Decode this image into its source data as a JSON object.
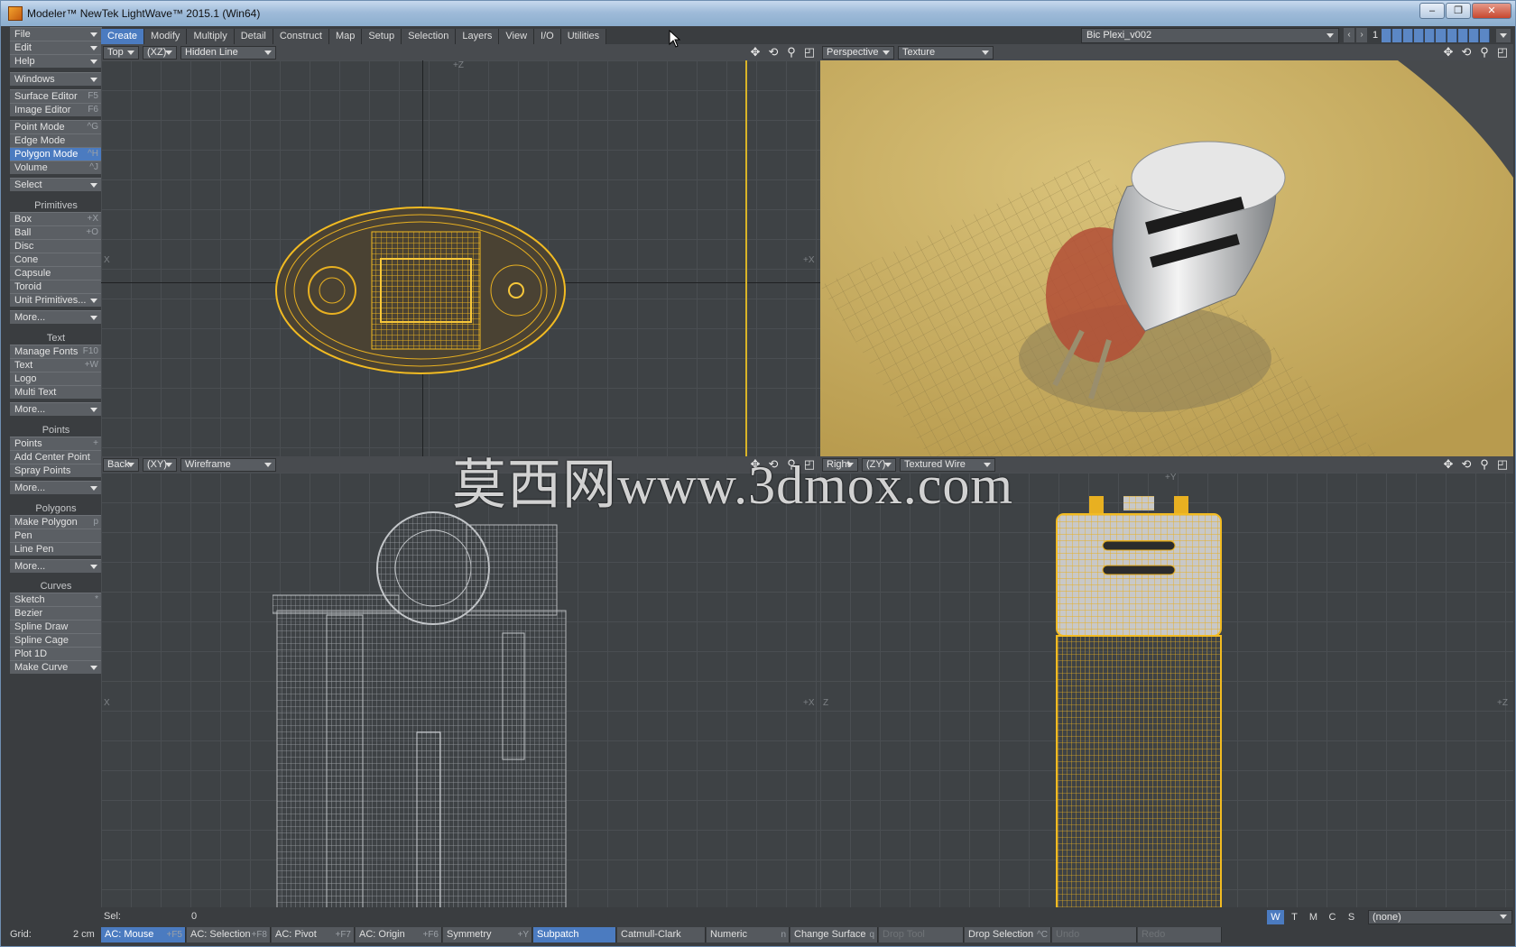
{
  "window": {
    "title": "Modeler™ NewTek LightWave™ 2015.1 (Win64)",
    "controls": [
      "–",
      "❐",
      "✕"
    ]
  },
  "left_menu": {
    "top": [
      {
        "label": "File",
        "dd": true
      },
      {
        "label": "Edit",
        "dd": true
      },
      {
        "label": "Help",
        "dd": true
      },
      {
        "label": "Windows",
        "dd": true
      },
      {
        "label": "Surface Editor",
        "shortcut": "F5"
      },
      {
        "label": "Image Editor",
        "shortcut": "F6"
      },
      {
        "label": "Point Mode",
        "shortcut": "^G"
      },
      {
        "label": "Edge Mode",
        "shortcut": ""
      },
      {
        "label": "Polygon Mode",
        "shortcut": "^H"
      },
      {
        "label": "Volume",
        "shortcut": "^J"
      },
      {
        "label": "Select",
        "dd": true
      }
    ],
    "primitives_header": "Primitives",
    "primitives": [
      {
        "label": "Box",
        "shortcut": "+X"
      },
      {
        "label": "Ball",
        "shortcut": "+O"
      },
      {
        "label": "Disc"
      },
      {
        "label": "Cone"
      },
      {
        "label": "Capsule"
      },
      {
        "label": "Toroid"
      },
      {
        "label": "Unit Primitives...",
        "dd": true
      },
      {
        "label": "More...",
        "dd": true
      }
    ],
    "text_header": "Text",
    "text": [
      {
        "label": "Manage Fonts",
        "shortcut": "F10"
      },
      {
        "label": "Text",
        "shortcut": "+W"
      },
      {
        "label": "Logo"
      },
      {
        "label": "Multi Text"
      },
      {
        "label": "More...",
        "dd": true
      }
    ],
    "points_header": "Points",
    "points": [
      {
        "label": "Points",
        "shortcut": "+"
      },
      {
        "label": "Add Center Point"
      },
      {
        "label": "Spray Points"
      },
      {
        "label": "More...",
        "dd": true
      }
    ],
    "polygons_header": "Polygons",
    "polygons": [
      {
        "label": "Make Polygon",
        "shortcut": "p"
      },
      {
        "label": "Pen"
      },
      {
        "label": "Line Pen"
      },
      {
        "label": "More...",
        "dd": true
      }
    ],
    "curves_header": "Curves",
    "curves": [
      {
        "label": "Sketch",
        "shortcut": "*"
      },
      {
        "label": "Bezier"
      },
      {
        "label": "Spline Draw"
      },
      {
        "label": "Spline Cage"
      },
      {
        "label": "Plot 1D"
      },
      {
        "label": "Make Curve",
        "dd": true
      }
    ]
  },
  "tabs": [
    "Create",
    "Modify",
    "Multiply",
    "Detail",
    "Construct",
    "Map",
    "Setup",
    "Selection",
    "Layers",
    "View",
    "I/O",
    "Utilities"
  ],
  "active_tab": "Create",
  "layer": {
    "name": "Bic Plexi_v002",
    "number": "1"
  },
  "viewports": {
    "top": {
      "view": "Top",
      "axes": "(XZ)",
      "mode": "Hidden Line",
      "axis_labels": {
        "top": "+Z",
        "left": "X",
        "right": "+X"
      }
    },
    "perspective": {
      "view": "Perspective",
      "mode": "Texture"
    },
    "back": {
      "view": "Back",
      "axes": "(XY)",
      "mode": "Wireframe",
      "axis_labels": {
        "left": "X",
        "right": "+X"
      }
    },
    "right": {
      "view": "Right",
      "axes": "(ZY)",
      "mode": "Textured Wire",
      "axis_labels": {
        "top": "+Y",
        "left": "Z",
        "right": "+Z"
      }
    }
  },
  "status": {
    "sel_label": "Sel:",
    "sel_value": "0",
    "grid_label": "Grid:",
    "grid_value": "2 cm",
    "wtmcs": [
      "W",
      "T",
      "M",
      "C",
      "S"
    ],
    "surface": "(none)",
    "buttons": [
      {
        "label": "AC: Mouse",
        "shortcut": "+F5",
        "on": true
      },
      {
        "label": "AC: Selection",
        "shortcut": "+F8"
      },
      {
        "label": "AC: Pivot",
        "shortcut": "+F7"
      },
      {
        "label": "AC: Origin",
        "shortcut": "+F6"
      },
      {
        "label": "Symmetry",
        "shortcut": "+Y"
      },
      {
        "label": "Subpatch",
        "on": true
      },
      {
        "label": "Catmull-Clark"
      },
      {
        "label": "Numeric",
        "shortcut": "n"
      },
      {
        "label": "Change Surface",
        "shortcut": "q"
      },
      {
        "label": "Drop Tool",
        "dim": true
      },
      {
        "label": "Drop Selection",
        "shortcut": "^C"
      },
      {
        "label": "Undo",
        "dim": true
      },
      {
        "label": "Redo",
        "dim": true
      }
    ]
  },
  "watermark": "莫西网www.3dmox.com",
  "colors": {
    "accent": "#4b7bc0",
    "wire_yellow": "#e8b021",
    "floor": "#c9b166",
    "panel": "#3a3d40"
  }
}
